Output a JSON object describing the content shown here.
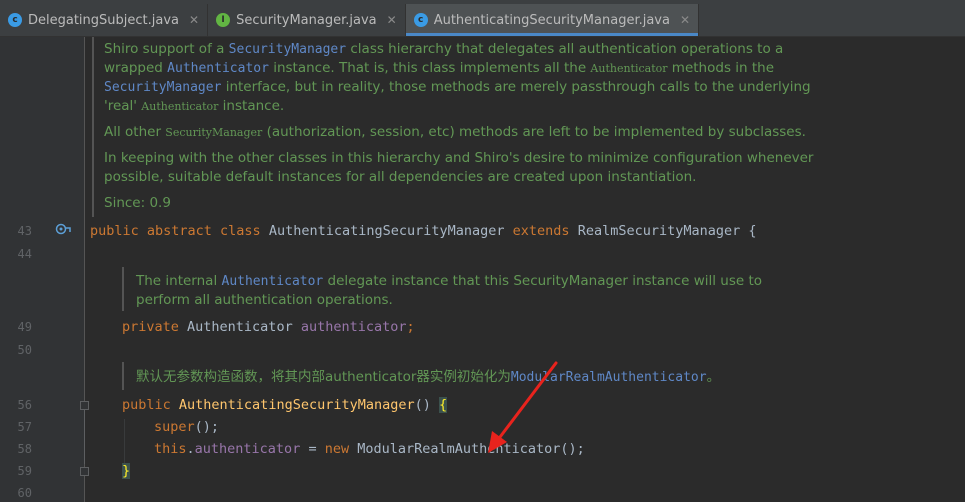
{
  "tabs": [
    {
      "label": "DelegatingSubject.java",
      "icon": "class-icon",
      "color": "#3a9be5",
      "active": false
    },
    {
      "label": "SecurityManager.java",
      "icon": "interface-icon",
      "color": "#62b543",
      "active": false
    },
    {
      "label": "AuthenticatingSecurityManager.java",
      "icon": "class-icon",
      "color": "#3a9be5",
      "active": true
    }
  ],
  "doc_top": {
    "p1_a": "Shiro support of a ",
    "p1_code1": "SecurityManager",
    "p1_b": " class hierarchy that delegates all authentication operations to a",
    "p1_c": "wrapped ",
    "p1_code2": "Authenticator",
    "p1_d": " instance. That is, this class implements all the ",
    "p1_ser1": "Authenticator",
    "p1_e": " methods in the",
    "p1_code3": "SecurityManager",
    "p1_f": " interface, but in reality, those methods are merely passthrough calls to the underlying",
    "p1_g": "'real' ",
    "p1_ser2": "Authenticator",
    "p1_h": " instance.",
    "p2_a": "All other ",
    "p2_ser": "SecurityManager",
    "p2_b": " (authorization, session, etc) methods are left to be implemented by subclasses.",
    "p3_a": "In keeping with the other classes in this hierarchy and Shiro's desire to minimize configuration whenever",
    "p3_b": "possible, suitable default instances for all dependencies are created upon instantiation.",
    "since": "Since: 0.9"
  },
  "doc_field": {
    "a": "The internal ",
    "code": "Authenticator",
    "b": " delegate instance that this SecurityManager instance will use to",
    "c": "perform all authentication operations."
  },
  "doc_ctor": {
    "a": "默认无参数构造函数，将其内部authenticator器实例初始化为",
    "code": "ModularRealmAuthenticator",
    "b": "。"
  },
  "line_numbers": {
    "l43": "43",
    "l44": "44",
    "l49": "49",
    "l50": "50",
    "l56": "56",
    "l57": "57",
    "l58": "58",
    "l59": "59",
    "l60": "60"
  },
  "code": {
    "class_kw": "public abstract class",
    "class_name": " AuthenticatingSecurityManager ",
    "extends_kw": "extends",
    "super_name": " RealmSecurityManager ",
    "open_brace": "{",
    "field_kw": "private",
    "field_type": " Authenticator ",
    "field_name": "authenticator",
    "semicolon": ";",
    "ctor_kw": "public",
    "ctor_name": " AuthenticatingSecurityManager",
    "ctor_parens": "() ",
    "ctor_brace": "{",
    "super_call": "super",
    "super_rest": "();",
    "this_kw": "this",
    "dot": ".",
    "assign_field": "authenticator",
    "assign_op": " = ",
    "new_kw": "new",
    "new_type": " ModularRealmAuthenticator();",
    "close_brace": "}"
  },
  "colors": {
    "keyword": "#cc7832",
    "field": "#9876aa",
    "method": "#ffc66d",
    "doc": "#629755",
    "arrow": "#e8231d"
  }
}
